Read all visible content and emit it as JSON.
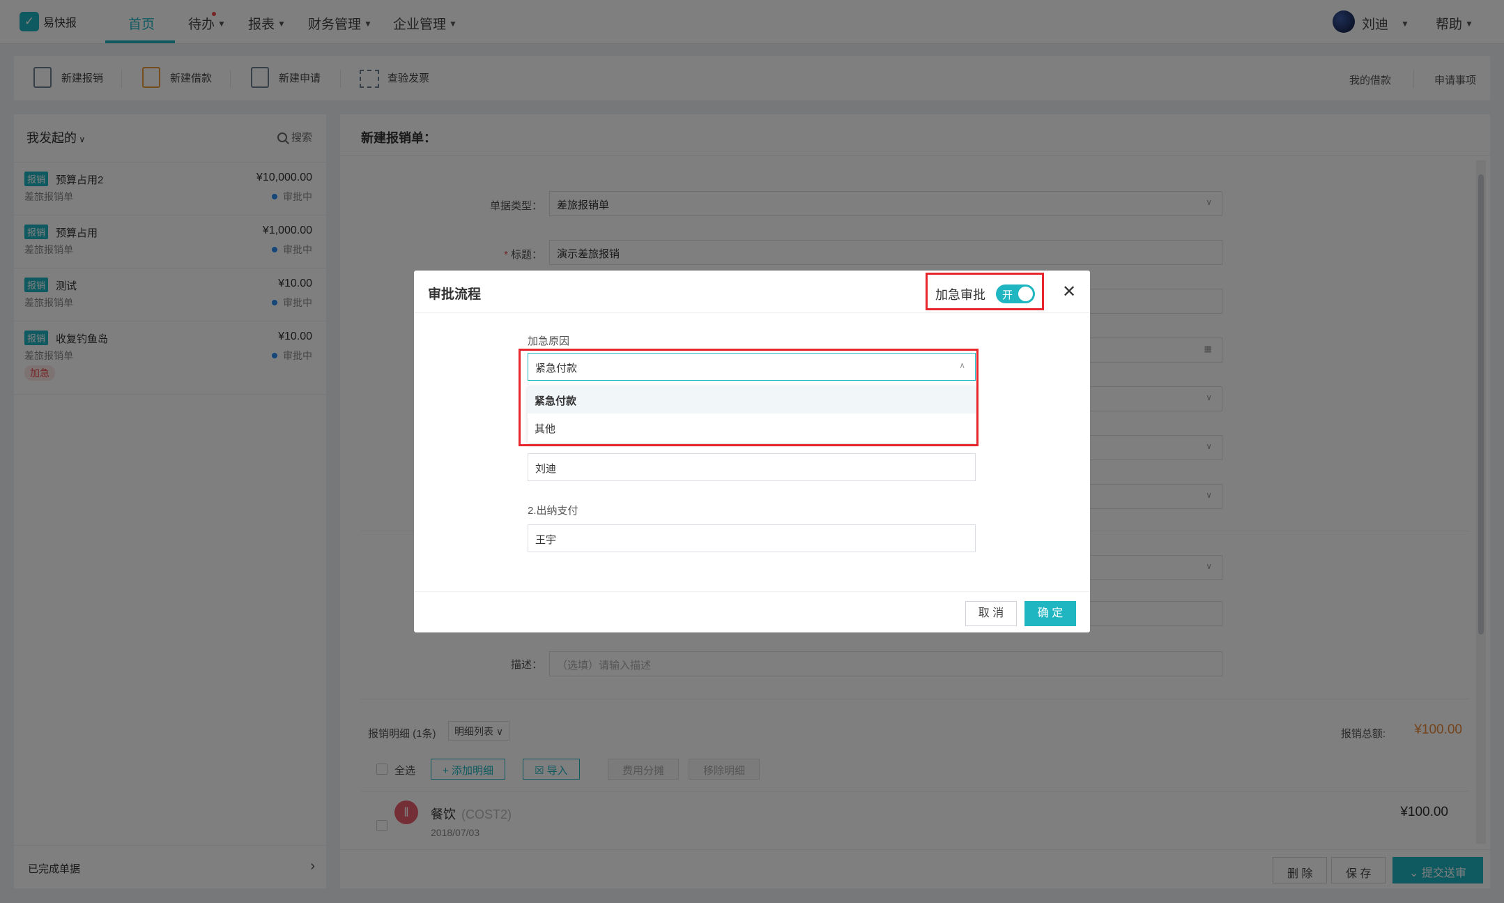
{
  "nav": {
    "logo_text": "易快报",
    "items": [
      {
        "label": "首页"
      },
      {
        "label": "待办"
      },
      {
        "label": "报表"
      },
      {
        "label": "财务管理"
      },
      {
        "label": "企业管理"
      }
    ],
    "user_name": "刘迪",
    "help_label": "帮助"
  },
  "toolbar": {
    "new_expense": "新建报销",
    "new_loan": "新建借款",
    "new_request": "新建申请",
    "check_invoice": "查验发票",
    "my_loans": "我的借款",
    "request_items": "申请事项"
  },
  "left_panel": {
    "filter_label": "我发起的",
    "search_label": "搜索",
    "items": [
      {
        "badge": "报销",
        "name": "预算占用2",
        "amount": "¥10,000.00",
        "type": "差旅报销单",
        "status": "审批中"
      },
      {
        "badge": "报销",
        "name": "预算占用",
        "amount": "¥1,000.00",
        "type": "差旅报销单",
        "status": "审批中"
      },
      {
        "badge": "报销",
        "name": "测试",
        "amount": "¥10.00",
        "type": "差旅报销单",
        "status": "审批中"
      },
      {
        "badge": "报销",
        "name": "收复钓鱼岛",
        "amount": "¥10.00",
        "type": "差旅报销单",
        "status": "审批中",
        "tag": "加急"
      }
    ],
    "completed_label": "已完成单据"
  },
  "form": {
    "title": "新建报销单：",
    "doc_type_label": "单据类型",
    "doc_type_value": "差旅报销单",
    "subject_label": "标题",
    "subject_value": "演示差旅报销",
    "description_label": "描述",
    "description_placeholder": "（选填）请输入描述",
    "detail_label": "报销明细 (1条)",
    "detail_view": "明细列表",
    "total_label": "报销总额:",
    "total_value": "¥100.00",
    "select_all": "全选",
    "add_detail": "添加明细",
    "import_label": "导入",
    "cost_split": "费用分摊",
    "remove_detail": "移除明细",
    "item_category": "餐饮",
    "item_code": "(COST2)",
    "item_date": "2018/07/03",
    "item_amount": "¥100.00"
  },
  "bottom": {
    "delete_label": "删 除",
    "save_label": "保 存",
    "submit_label": "提交送审"
  },
  "dialog": {
    "title": "审批流程",
    "urgent_label": "加急审批",
    "toggle_text": "开",
    "reason_label": "加急原因",
    "reason_value": "紧急付款",
    "options": [
      "紧急付款",
      "其他"
    ],
    "step1_value": "刘迪",
    "step2_label": "2.出纳支付",
    "step2_value": "王宇",
    "cancel_label": "取 消",
    "ok_label": "确 定"
  },
  "colors": {
    "accent": "#1fb5c1",
    "highlight_box": "#e5262c",
    "amount_orange": "#e8883a"
  }
}
